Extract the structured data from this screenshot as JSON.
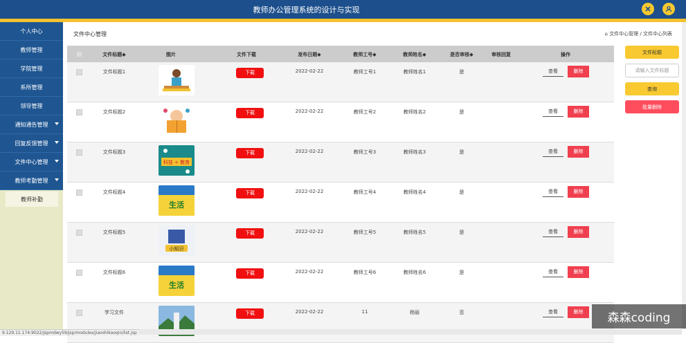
{
  "app": {
    "title": "教师办公管理系统的设计与实现"
  },
  "header_icons": [
    "close-circle-icon",
    "user-icon"
  ],
  "sidebar": {
    "items": [
      {
        "label": "个人中心",
        "caret": false
      },
      {
        "label": "教师管理",
        "caret": false
      },
      {
        "label": "学院管理",
        "caret": false
      },
      {
        "label": "系所管理",
        "caret": false
      },
      {
        "label": "领导管理",
        "caret": false
      },
      {
        "label": "通知通告管理",
        "caret": true
      },
      {
        "label": "回复反馈管理",
        "caret": true
      },
      {
        "label": "文件中心管理",
        "caret": true
      },
      {
        "label": "教师考勤管理",
        "caret": true
      }
    ],
    "subitem": {
      "label": "教师补勤"
    }
  },
  "page": {
    "title": "文件中心管理",
    "breadcrumb": "文件中心管理 / 文件中心列表"
  },
  "table": {
    "headers": [
      "文件标题◆",
      "图片",
      "文件下载",
      "发布日期◆",
      "教师工号◆",
      "教师姓名◆",
      "是否审核◆",
      "审核回复",
      "操作"
    ],
    "rows": [
      {
        "title": "文件标题1",
        "date": "2022-02-22",
        "teacher_id": "教师工号1",
        "teacher_name": "教师姓名1",
        "reviewed": "是",
        "reply": "",
        "thumb": "teacher-illustration"
      },
      {
        "title": "文件标题2",
        "date": "2022-02-22",
        "teacher_id": "教师工号2",
        "teacher_name": "教师姓名2",
        "reviewed": "是",
        "reply": "",
        "thumb": "reading-illustration"
      },
      {
        "title": "文件标题3",
        "date": "2022-02-22",
        "teacher_id": "教师工号3",
        "teacher_name": "教师姓名3",
        "reviewed": "是",
        "reply": "",
        "thumb": "science-poster"
      },
      {
        "title": "文件标题4",
        "date": "2022-02-22",
        "teacher_id": "教师工号4",
        "teacher_name": "教师姓名4",
        "reviewed": "是",
        "reply": "",
        "thumb": "life-poster"
      },
      {
        "title": "文件标题5",
        "date": "2022-02-22",
        "teacher_id": "教师工号5",
        "teacher_name": "教师姓名5",
        "reviewed": "是",
        "reply": "",
        "thumb": "knowledge-poster"
      },
      {
        "title": "文件标题6",
        "date": "2022-02-22",
        "teacher_id": "教师工号6",
        "teacher_name": "教师姓名6",
        "reviewed": "是",
        "reply": "",
        "thumb": "life-poster"
      },
      {
        "title": "学习文件",
        "date": "2022-02-22",
        "teacher_id": "11",
        "teacher_name": "杨丽",
        "reviewed": "否",
        "reply": "",
        "thumb": "landscape-photo"
      }
    ],
    "download_label": "下载",
    "view_label": "查看",
    "delete_label": "删除"
  },
  "thumb_text": {
    "science": "科技 + 教育",
    "life": "生活",
    "knowledge": "小知识"
  },
  "right_panel": {
    "filter_label": "文件标题",
    "search_placeholder": "请输入文件标题",
    "query_button": "查询",
    "batch_delete_button": "批量删除"
  },
  "statusbar": {
    "url": "9.129.11.174:9022/jspmdwy59/jsp/modules/jiaoshikaoqin/list.jsp"
  },
  "watermark": {
    "text": "森森coding"
  },
  "colors": {
    "nav_blue": "#1f5692",
    "accent_yellow": "#f8c930",
    "danger_red": "#f04050",
    "download_red": "#f01010"
  }
}
